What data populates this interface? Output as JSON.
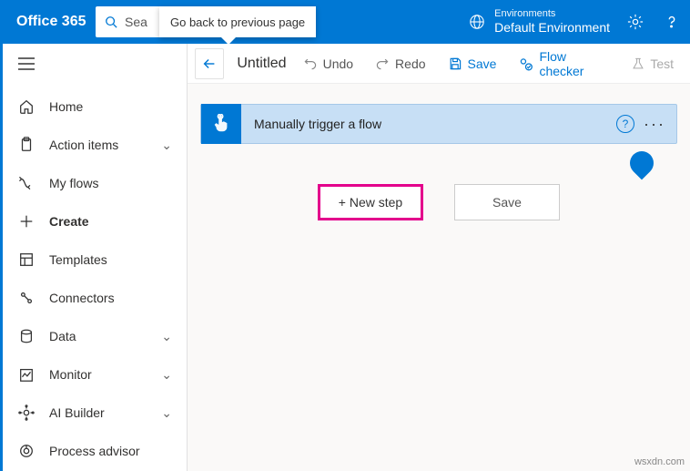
{
  "header": {
    "brand": "Office 365",
    "search_truncated": "Sea",
    "tooltip": "Go back to previous page",
    "env_label": "Environments",
    "env_value": "Default Environment"
  },
  "sidebar": {
    "items": [
      {
        "label": "Home",
        "expandable": false
      },
      {
        "label": "Action items",
        "expandable": true
      },
      {
        "label": "My flows",
        "expandable": false
      },
      {
        "label": "Create",
        "expandable": false,
        "active": true
      },
      {
        "label": "Templates",
        "expandable": false
      },
      {
        "label": "Connectors",
        "expandable": false
      },
      {
        "label": "Data",
        "expandable": true
      },
      {
        "label": "Monitor",
        "expandable": true
      },
      {
        "label": "AI Builder",
        "expandable": true
      },
      {
        "label": "Process advisor",
        "expandable": false
      }
    ]
  },
  "toolbar": {
    "title": "Untitled",
    "undo": "Undo",
    "redo": "Redo",
    "save": "Save",
    "checker": "Flow checker",
    "test": "Test"
  },
  "trigger": {
    "label": "Manually trigger a flow"
  },
  "buttons": {
    "new_step": "+ New step",
    "save": "Save"
  },
  "watermark": "wsxdn.com"
}
